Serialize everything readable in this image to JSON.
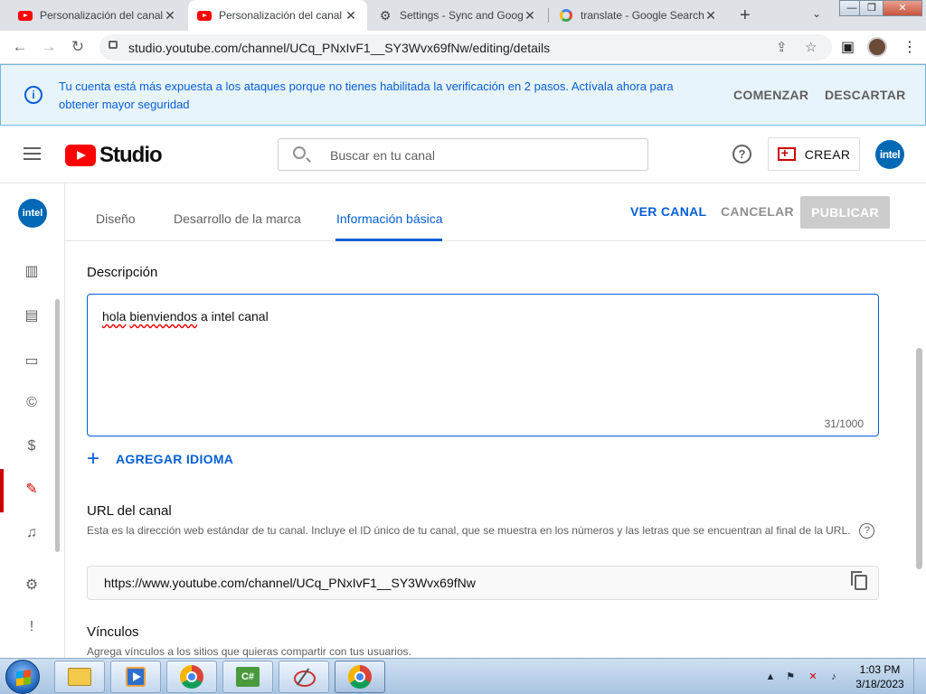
{
  "browser": {
    "tabs": [
      {
        "title": "Personalización del canal",
        "favicon": "youtube-icon",
        "active": false
      },
      {
        "title": "Personalización del canal",
        "favicon": "youtube-icon",
        "active": true
      },
      {
        "title": "Settings - Sync and Goog",
        "favicon": "gear-icon",
        "active": false
      },
      {
        "title": "translate - Google Search",
        "favicon": "google-icon",
        "active": false
      }
    ],
    "url": "studio.youtube.com/channel/UCq_PNxIvF1__SY3Wvx69fNw/editing/details"
  },
  "banner": {
    "message": "Tu cuenta está más expuesta a los ataques porque no tienes habilitada la verificación en 2 pasos. Actívala ahora para obtener mayor seguridad",
    "start_label": "COMENZAR",
    "dismiss_label": "DESCARTAR",
    "color": "#065fd4"
  },
  "header": {
    "logo_text": "Studio",
    "search_placeholder": "Buscar en tu canal",
    "create_label": "CREAR",
    "avatar_text": "intel"
  },
  "rail": {
    "avatar_text": "intel",
    "items": [
      "panel-icon",
      "analytics-icon",
      "content-icon",
      "subtitles-icon",
      "copyright-icon",
      "monetization-icon",
      "customization-icon",
      "audio-library-icon",
      "settings-icon",
      "feedback-icon"
    ],
    "active_item": "customization-icon"
  },
  "subtabs": {
    "items": [
      {
        "label": "Diseño",
        "active": false
      },
      {
        "label": "Desarrollo de la marca",
        "active": false
      },
      {
        "label": "Información básica",
        "active": true
      }
    ],
    "view_channel": "VER CANAL",
    "cancel": "CANCELAR",
    "publish": "PUBLICAR"
  },
  "main": {
    "description": {
      "title": "Descripción",
      "value_misspelled_1": "hola",
      "value_misspelled_2": "bienviendos",
      "value_rest": " a intel canal",
      "counter": "31/1000"
    },
    "add_language": "AGREGAR IDIOMA",
    "channel_url": {
      "title": "URL del canal",
      "help": "Esta es la dirección web estándar de tu canal. Incluye el ID único de tu canal, que se muestra en los números y las letras que se encuentran al final de la URL.",
      "value": "https://www.youtube.com/channel/UCq_PNxIvF1__SY3Wvx69fNw"
    },
    "links": {
      "title": "Vínculos",
      "help": "Agrega vínculos a los sitios que quieras compartir con tus usuarios."
    }
  },
  "taskbar": {
    "apps": [
      "file-explorer-icon",
      "media-player-icon",
      "chrome-icon",
      "csharp-icon",
      "snipping-tool-icon",
      "chrome-profile-icon"
    ],
    "time": "1:03 PM",
    "date": "3/18/2023"
  }
}
